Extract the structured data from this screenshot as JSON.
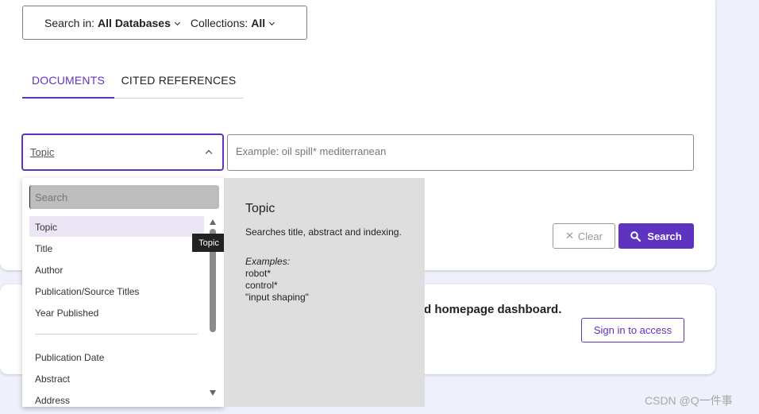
{
  "db_bar": {
    "search_in_label": "Search in:",
    "search_in_value": "All Databases",
    "collections_label": "Collections:",
    "collections_value": "All"
  },
  "tabs": [
    {
      "label": "DOCUMENTS",
      "active": true
    },
    {
      "label": "CITED REFERENCES",
      "active": false
    }
  ],
  "field_select": {
    "value": "Topic"
  },
  "query": {
    "placeholder": "Example: oil spill* mediterranean"
  },
  "buttons": {
    "clear": "Clear",
    "search": "Search"
  },
  "promo": {
    "text": "d homepage dashboard.",
    "signin": "Sign in to access"
  },
  "dropdown": {
    "search_placeholder": "Search",
    "options": [
      "Topic",
      "Title",
      "Author",
      "Publication/Source Titles",
      "Year Published"
    ],
    "options_more": [
      "Publication Date",
      "Abstract",
      "Address"
    ],
    "selected": "Topic",
    "tooltip": "Topic"
  },
  "description": {
    "title": "Topic",
    "text": "Searches title, abstract and indexing.",
    "examples_label": "Examples:",
    "examples": [
      "robot*",
      "control*",
      "\"input shaping\""
    ]
  },
  "watermark": "CSDN @Q一件事",
  "colors": {
    "accent": "#5e33bf",
    "background": "#eef0fb",
    "selected_bg": "#ebe5f6",
    "panel_bg": "#dedede"
  }
}
